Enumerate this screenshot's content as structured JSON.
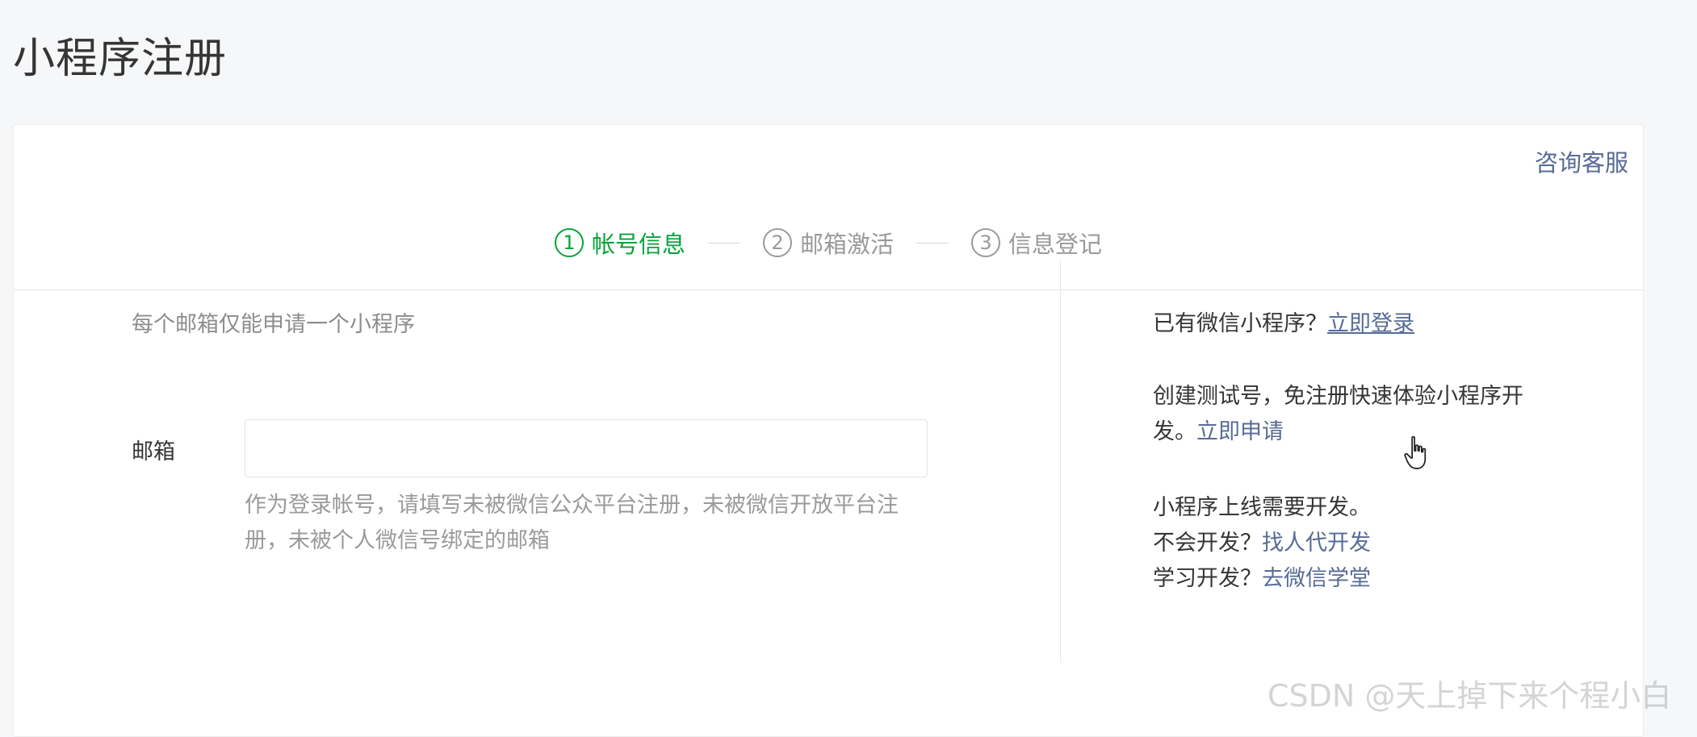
{
  "page": {
    "title": "小程序注册"
  },
  "header": {
    "consult_label": "咨询客服"
  },
  "steps": [
    {
      "num": "1",
      "label": "帐号信息",
      "active": true
    },
    {
      "num": "2",
      "label": "邮箱激活",
      "active": false
    },
    {
      "num": "3",
      "label": "信息登记",
      "active": false
    }
  ],
  "form": {
    "hint": "每个邮箱仅能申请一个小程序",
    "email_label": "邮箱",
    "email_value": "",
    "email_placeholder": "",
    "email_tip": "作为登录帐号，请填写未被微信公众平台注册，未被微信开放平台注册，未被个人微信号绑定的邮箱"
  },
  "sidebar": {
    "login_prefix": "已有微信小程序？",
    "login_link": "立即登录",
    "test_text": "创建测试号，免注册快速体验小程序开发。",
    "test_link": "立即申请",
    "dev_line": "小程序上线需要开发。",
    "outsource_prefix": "不会开发？",
    "outsource_link": "找人代开发",
    "learn_prefix": "学习开发？",
    "learn_link": "去微信学堂"
  },
  "watermark": "CSDN @天上掉下来个程小白",
  "colors": {
    "accent_green": "#07a23a",
    "link_blue": "#576b95",
    "muted_gray": "#9a9a9a"
  }
}
